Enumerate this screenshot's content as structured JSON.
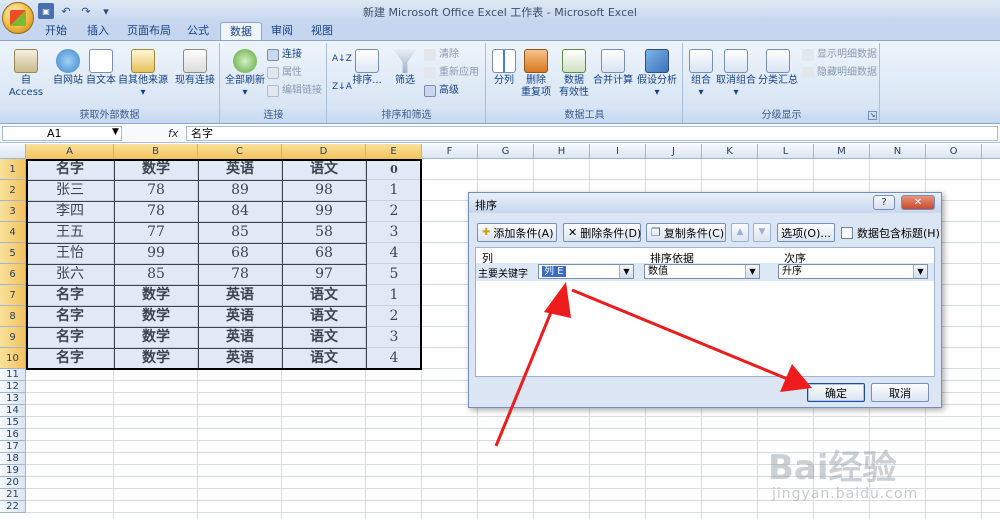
{
  "window": {
    "title": "新建 Microsoft Office Excel 工作表 - Microsoft Excel"
  },
  "tabs": [
    "开始",
    "插入",
    "页面布局",
    "公式",
    "数据",
    "审阅",
    "视图"
  ],
  "active_tab": "数据",
  "ribbon": {
    "external": {
      "label": "获取外部数据",
      "buttons": [
        "自 Access",
        "自网站",
        "自文本",
        "自其他来源",
        "现有连接"
      ]
    },
    "connections": {
      "label": "连接",
      "main": "全部刷新",
      "small": [
        "连接",
        "属性",
        "编辑链接"
      ]
    },
    "sortfilter": {
      "label": "排序和筛选",
      "sort": "排序...",
      "filter": "筛选",
      "small": [
        "清除",
        "重新应用",
        "高级"
      ]
    },
    "datatools": {
      "label": "数据工具",
      "buttons": [
        "分列",
        "删除\n重复项",
        "数据\n有效性",
        "合并计算",
        "假设分析"
      ]
    },
    "outline": {
      "label": "分级显示",
      "buttons": [
        "组合",
        "取消组合",
        "分类汇总"
      ],
      "small": [
        "显示明细数据",
        "隐藏明细数据"
      ]
    }
  },
  "formula_bar": {
    "name_box": "A1",
    "fx": "fx",
    "value": "名字"
  },
  "columns": [
    "A",
    "B",
    "C",
    "D",
    "E",
    "F",
    "G",
    "H",
    "I",
    "J",
    "K",
    "L",
    "M",
    "N",
    "O"
  ],
  "rows": [
    "1",
    "2",
    "3",
    "4",
    "5",
    "6",
    "7",
    "8",
    "9",
    "10",
    "11",
    "12",
    "13",
    "14",
    "15",
    "16",
    "17",
    "18",
    "19",
    "20",
    "21",
    "22"
  ],
  "table": [
    [
      "名字",
      "数学",
      "英语",
      "语文",
      "0"
    ],
    [
      "张三",
      "78",
      "89",
      "98",
      "1"
    ],
    [
      "李四",
      "78",
      "84",
      "99",
      "2"
    ],
    [
      "王五",
      "77",
      "85",
      "58",
      "3"
    ],
    [
      "王怡",
      "99",
      "68",
      "68",
      "4"
    ],
    [
      "张六",
      "85",
      "78",
      "97",
      "5"
    ],
    [
      "名字",
      "数学",
      "英语",
      "语文",
      "1"
    ],
    [
      "名字",
      "数学",
      "英语",
      "语文",
      "2"
    ],
    [
      "名字",
      "数学",
      "英语",
      "语文",
      "3"
    ],
    [
      "名字",
      "数学",
      "英语",
      "语文",
      "4"
    ]
  ],
  "dialog": {
    "title": "排序",
    "help": "?",
    "close": "✕",
    "add_level": "添加条件(A)",
    "delete_level": "删除条件(D)",
    "copy_level": "复制条件(C)",
    "options": "选项(O)...",
    "has_headers": "数据包含标题(H)",
    "col_header": "列",
    "sorton_header": "排序依据",
    "order_header": "次序",
    "row_label": "主要关键字",
    "column_value": "列 E",
    "sorton_value": "数值",
    "order_value": "升序",
    "ok": "确定",
    "cancel": "取消"
  },
  "watermark": {
    "text": "Bai经验",
    "url": "jingyan.baidu.com"
  }
}
